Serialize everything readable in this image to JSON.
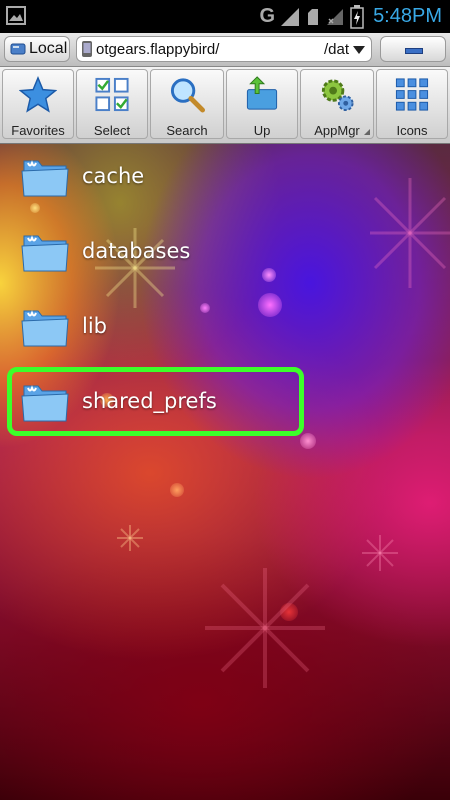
{
  "status_bar": {
    "network_label": "G",
    "clock": "5:48PM"
  },
  "address_bar": {
    "location_label": "Local",
    "path_text": "otgears.flappybird/",
    "path_tail": "/dat"
  },
  "toolbar": {
    "items": [
      {
        "label": "Favorites",
        "icon": "star-icon"
      },
      {
        "label": "Select",
        "icon": "checklist-icon"
      },
      {
        "label": "Search",
        "icon": "magnifier-icon"
      },
      {
        "label": "Up",
        "icon": "folder-up-icon"
      },
      {
        "label": "AppMgr",
        "icon": "gears-icon"
      },
      {
        "label": "Icons",
        "icon": "grid-icon"
      }
    ]
  },
  "files": [
    {
      "name": "cache"
    },
    {
      "name": "databases"
    },
    {
      "name": "lib"
    },
    {
      "name": "shared_prefs",
      "highlighted": true
    }
  ],
  "colors": {
    "clock": "#39a9e6",
    "highlight": "#3cff2a"
  }
}
